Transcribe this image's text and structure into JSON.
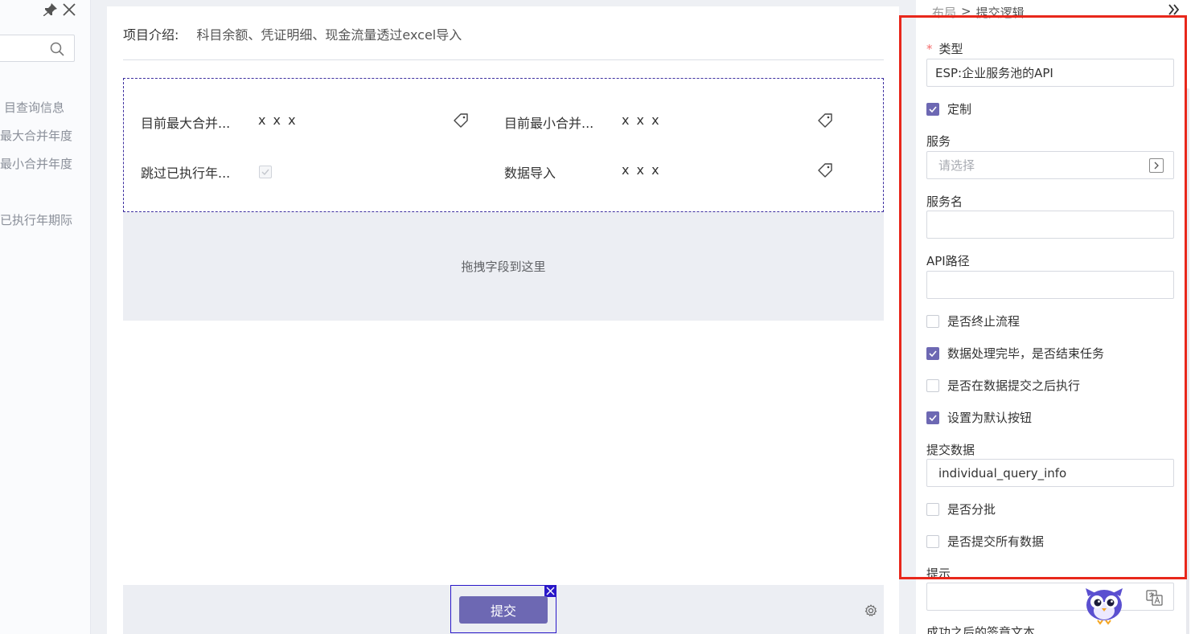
{
  "left_panel": {
    "search_placeholder": "",
    "items": [
      {
        "label": "目查询信息"
      },
      {
        "label": "最大合并年度"
      },
      {
        "label": "最小合并年度"
      },
      {
        "label": "已执行年期际"
      }
    ]
  },
  "main": {
    "intro_label": "项目介绍:",
    "intro_value": "科目余额、凭证明细、现金流量透过excel导入",
    "fields": [
      {
        "label": "目前最大合并...",
        "value": "x x x"
      },
      {
        "label": "目前最小合并...",
        "value": "x x x"
      },
      {
        "label": "跳过已执行年..."
      },
      {
        "label": "数据导入",
        "value": "x x x"
      }
    ],
    "drop_zone_text": "拖拽字段到这里",
    "submit_label": "提交"
  },
  "right_panel": {
    "breadcrumb_parent": "布局",
    "breadcrumb_sep": ">",
    "breadcrumb_current": "提交逻辑",
    "type_required_mark": "*",
    "type_label": "类型",
    "type_value": "ESP:企业服务池的API",
    "custom_label": "定制",
    "custom_checked": true,
    "service_label": "服务",
    "service_placeholder": "请选择",
    "service_name_label": "服务名",
    "service_name_value": "",
    "api_path_label": "API路径",
    "api_path_value": "",
    "checkboxes": [
      {
        "label": "是否终止流程",
        "checked": false
      },
      {
        "label": "数据处理完毕，是否结束任务",
        "checked": true
      },
      {
        "label": "是否在数据提交之后执行",
        "checked": false
      },
      {
        "label": "设置为默认按钮",
        "checked": true
      }
    ],
    "submit_data_label": "提交数据",
    "submit_data_value": "individual_query_info",
    "checkboxes2": [
      {
        "label": "是否分批",
        "checked": false
      },
      {
        "label": "是否提交所有数据",
        "checked": false
      }
    ],
    "tip_label": "提示",
    "tip_value": "",
    "success_text_label": "成功之后的签章文本"
  },
  "colors": {
    "accent": "#6d68b3",
    "highlight_frame": "#e8271b",
    "selection_frame": "#2a18c8"
  }
}
